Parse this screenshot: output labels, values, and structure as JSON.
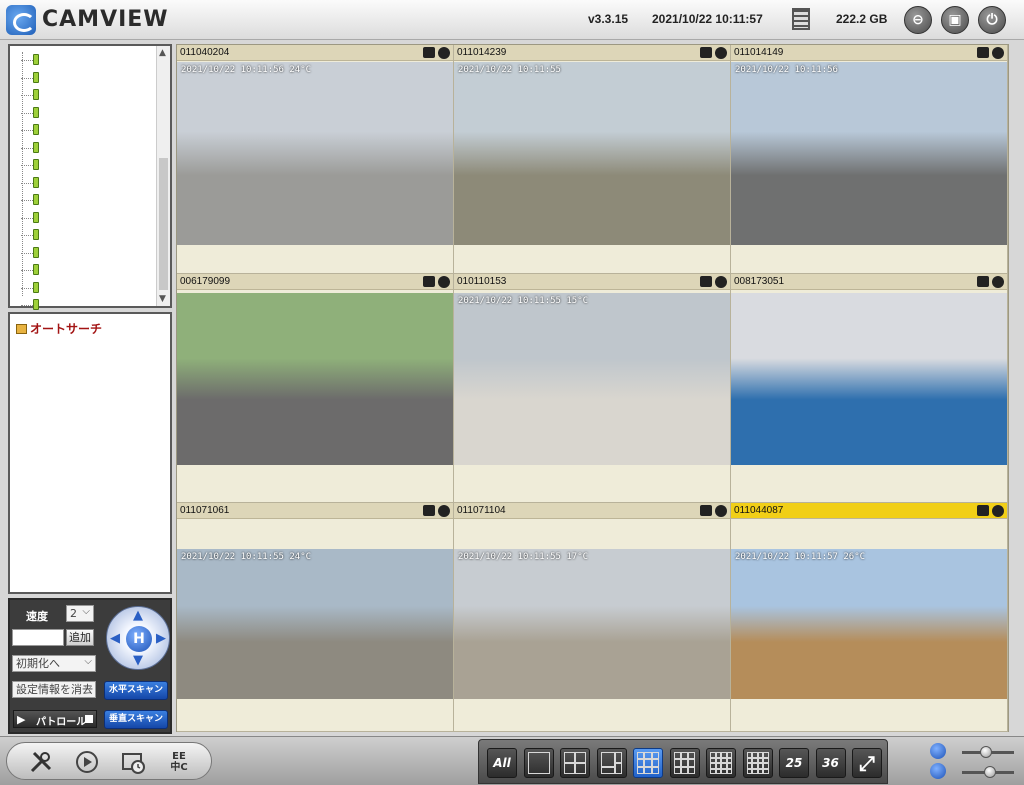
{
  "header": {
    "app_title": "CAMVIEW",
    "version": "v3.3.15",
    "datetime": "2021/10/22 10:11:57",
    "storage": "222.2 GB",
    "minimize_glyph": "⊖",
    "restore_glyph": "▣",
    "power_glyph": "⏻"
  },
  "sidebar": {
    "tree_nodes_count_visible": 15,
    "auto_search_label": "オートサーチ"
  },
  "ptz": {
    "speed_label": "速度",
    "speed_value": "2",
    "add_button": "追加",
    "reset_select": "初期化へ",
    "delete_select": "設定情報を消去",
    "h_scan_button": "水平スキャン",
    "v_scan_button": "垂直スキャン",
    "patrol_label": "パトロール",
    "home_label": "H"
  },
  "cameras": [
    {
      "id": "011040204",
      "stamp": "2021/10/22 10:11:56 24°C",
      "active": false,
      "sky": "#c9cfd6",
      "ground": "#9b9b98"
    },
    {
      "id": "011014239",
      "stamp": "2021/10/22 10:11:55",
      "active": false,
      "sky": "#c3cdd4",
      "ground": "#8d8a78"
    },
    {
      "id": "011014149",
      "stamp": "2021/10/22 10:11:56",
      "active": false,
      "sky": "#b8c8d8",
      "ground": "#6f7070"
    },
    {
      "id": "006179099",
      "stamp": "",
      "active": false,
      "sky": "#8fb07a",
      "ground": "#6c6b6b"
    },
    {
      "id": "010110153",
      "stamp": "2021/10/22 10:11:55 15°C",
      "active": false,
      "sky": "#bfc6cc",
      "ground": "#d9d6cf"
    },
    {
      "id": "008173051",
      "stamp": "",
      "active": false,
      "sky": "#d9dbe0",
      "ground": "#2e6fae"
    },
    {
      "id": "011071061",
      "stamp": "2021/10/22 10:11:55 24°C",
      "active": false,
      "sky": "#a9b9c7",
      "ground": "#8e8a80"
    },
    {
      "id": "011071104",
      "stamp": "2021/10/22 10:11:55 17°C",
      "active": false,
      "sky": "#c7ccd1",
      "ground": "#a9a294"
    },
    {
      "id": "011044087",
      "stamp": "2021/10/22 10:11:57 26°C",
      "active": true,
      "sky": "#a9c4e0",
      "ground": "#b58d5a"
    }
  ],
  "layout_buttons": [
    {
      "name": "all",
      "text": "All"
    },
    {
      "name": "1x1",
      "text": ""
    },
    {
      "name": "2x2",
      "text": ""
    },
    {
      "name": "1plus3",
      "text": ""
    },
    {
      "name": "3x3",
      "text": ""
    },
    {
      "name": "1plus5",
      "text": ""
    },
    {
      "name": "4x4",
      "text": ""
    },
    {
      "name": "1plus12",
      "text": ""
    },
    {
      "name": "25",
      "text": "25"
    },
    {
      "name": "36",
      "text": "36"
    },
    {
      "name": "fullscreen",
      "text": ""
    }
  ],
  "tools": {
    "settings_icon": "wrench-icon",
    "playback_icon": "playback-icon",
    "schedule_icon": "schedule-icon",
    "language_label": "EE\n中C"
  }
}
